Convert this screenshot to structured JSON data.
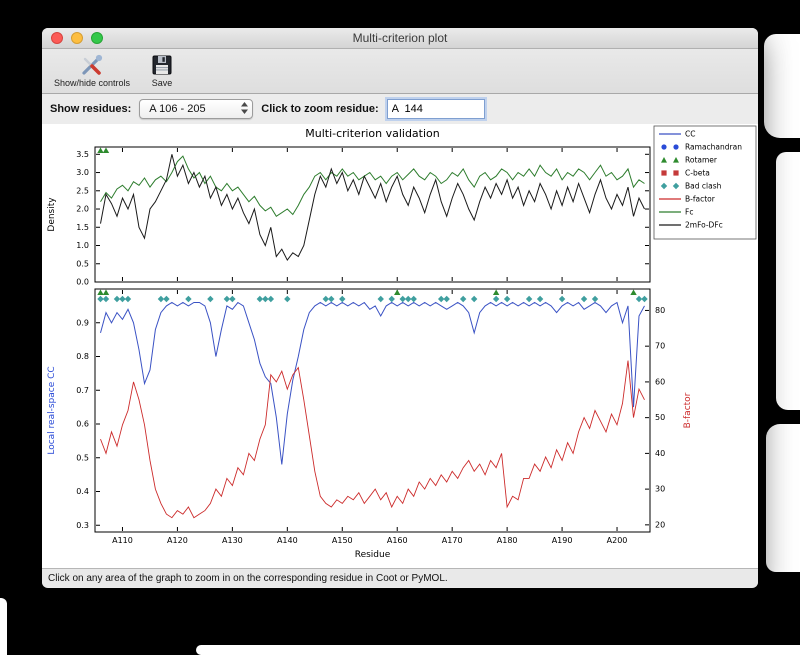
{
  "window": {
    "title": "Multi-criterion plot"
  },
  "toolbar": {
    "show_hide_label": "Show/hide controls",
    "save_label": "Save"
  },
  "controls": {
    "show_residues_label": "Show residues:",
    "residue_range_value": "A 106 - 205",
    "zoom_residue_label": "Click to zoom residue:",
    "zoom_residue_value": "A  144"
  },
  "status": {
    "text": "Click on any area of the graph to zoom in on the corresponding residue in Coot or PyMOL."
  },
  "chart_data": [
    {
      "type": "line",
      "title": "Multi-criterion validation",
      "ylabel": "Density",
      "ylim": [
        0,
        3.7
      ],
      "yticks": [
        0.0,
        0.5,
        1.0,
        1.5,
        2.0,
        2.5,
        3.0,
        3.5
      ],
      "xlim": [
        105,
        206
      ],
      "x_start": 106,
      "series": [
        {
          "name": "Fc",
          "color": "#2e7d2e",
          "width": 1,
          "values": [
            2.2,
            2.45,
            2.3,
            2.55,
            2.65,
            2.5,
            2.75,
            2.65,
            2.85,
            2.6,
            2.8,
            2.9,
            2.75,
            3.0,
            3.3,
            3.45,
            3.1,
            2.85,
            3.0,
            2.7,
            2.9,
            2.6,
            2.5,
            2.7,
            2.5,
            2.6,
            2.4,
            2.2,
            2.35,
            2.1,
            1.95,
            2.05,
            1.8,
            1.9,
            2.0,
            1.85,
            2.1,
            2.4,
            2.6,
            2.9,
            3.0,
            2.8,
            3.0,
            2.9,
            3.1,
            2.9,
            3.0,
            2.8,
            2.9,
            3.0,
            2.8,
            2.9,
            2.7,
            2.9,
            3.0,
            2.8,
            2.95,
            3.1,
            2.9,
            2.8,
            3.0,
            2.9,
            2.7,
            2.8,
            3.0,
            2.9,
            3.1,
            2.8,
            2.6,
            2.9,
            3.0,
            2.8,
            2.9,
            3.1,
            3.0,
            2.8,
            3.0,
            2.9,
            3.1,
            2.9,
            3.2,
            3.0,
            2.9,
            3.1,
            2.8,
            3.0,
            2.9,
            3.1,
            3.0,
            2.8,
            3.0,
            3.2,
            2.9,
            3.0,
            2.8,
            2.9,
            3.1,
            2.6,
            2.8,
            2.7
          ]
        },
        {
          "name": "2mFo-DFc",
          "color": "#1a1a1a",
          "width": 1,
          "values": [
            1.6,
            2.4,
            2.15,
            1.8,
            2.3,
            2.0,
            2.4,
            1.5,
            1.2,
            2.0,
            2.2,
            2.5,
            2.8,
            3.5,
            2.9,
            3.2,
            2.7,
            3.0,
            2.6,
            2.9,
            2.3,
            2.6,
            2.1,
            2.4,
            2.0,
            2.3,
            1.9,
            1.6,
            2.0,
            1.3,
            1.0,
            1.5,
            0.7,
            0.9,
            0.6,
            0.8,
            0.7,
            1.0,
            1.7,
            2.4,
            2.9,
            2.6,
            3.1,
            2.7,
            3.0,
            2.5,
            2.8,
            2.4,
            2.9,
            2.6,
            2.3,
            2.7,
            2.2,
            2.6,
            2.9,
            2.4,
            2.1,
            2.6,
            2.3,
            1.9,
            2.4,
            2.8,
            2.2,
            1.8,
            2.3,
            2.7,
            2.4,
            2.0,
            1.7,
            2.2,
            2.6,
            2.3,
            2.7,
            2.4,
            2.8,
            2.3,
            2.6,
            2.1,
            2.5,
            2.2,
            2.7,
            2.4,
            2.0,
            2.5,
            2.1,
            2.6,
            2.2,
            2.7,
            2.3,
            1.9,
            2.4,
            2.8,
            2.3,
            2.0,
            2.4,
            2.1,
            2.6,
            1.8,
            2.3,
            2.0
          ]
        }
      ],
      "markers": [
        {
          "name": "Rotamer",
          "shape": "triangle",
          "color": "#2e8b2e",
          "residues": [
            106,
            107
          ]
        }
      ],
      "legend": {
        "entries": [
          {
            "label": "CC",
            "type": "line",
            "color": "#3a52c4"
          },
          {
            "label": "Ramachandran",
            "type": "circle",
            "color": "#2a4bd7"
          },
          {
            "label": "Rotamer",
            "type": "triangle",
            "color": "#2e8b2e"
          },
          {
            "label": "C-beta",
            "type": "square",
            "color": "#c43a3a"
          },
          {
            "label": "Bad clash",
            "type": "diamond",
            "color": "#3f9f9f"
          },
          {
            "label": "B-factor",
            "type": "line",
            "color": "#cc2b2b"
          },
          {
            "label": "Fc",
            "type": "line",
            "color": "#2e7d2e"
          },
          {
            "label": "2mFo-DFc",
            "type": "line",
            "color": "#1a1a1a"
          }
        ]
      }
    },
    {
      "type": "line",
      "xlabel": "Residue",
      "ylabel": "Local real-space CC",
      "ylabel_color": "#2a4bd7",
      "ylim": [
        0.28,
        1.0
      ],
      "yticks": [
        0.3,
        0.4,
        0.5,
        0.6,
        0.7,
        0.8,
        0.9
      ],
      "y2label": "B-factor",
      "y2label_color": "#cc2b2b",
      "y2lim": [
        18,
        86
      ],
      "y2ticks": [
        20,
        30,
        40,
        50,
        60,
        70,
        80
      ],
      "xlim": [
        105,
        206
      ],
      "x_start": 106,
      "xticks": [
        110,
        120,
        130,
        140,
        150,
        160,
        170,
        180,
        190,
        200
      ],
      "xtick_prefix": "A",
      "series": [
        {
          "name": "CC",
          "axis": "left",
          "color": "#3a52c4",
          "width": 1,
          "values": [
            0.87,
            0.93,
            0.9,
            0.93,
            0.91,
            0.94,
            0.9,
            0.82,
            0.72,
            0.76,
            0.88,
            0.93,
            0.95,
            0.96,
            0.95,
            0.96,
            0.95,
            0.96,
            0.96,
            0.95,
            0.9,
            0.8,
            0.88,
            0.95,
            0.94,
            0.96,
            0.95,
            0.9,
            0.85,
            0.78,
            0.74,
            0.72,
            0.62,
            0.48,
            0.63,
            0.73,
            0.8,
            0.88,
            0.93,
            0.95,
            0.96,
            0.95,
            0.96,
            0.95,
            0.96,
            0.95,
            0.96,
            0.95,
            0.96,
            0.94,
            0.95,
            0.92,
            0.95,
            0.96,
            0.95,
            0.96,
            0.95,
            0.96,
            0.95,
            0.96,
            0.95,
            0.96,
            0.95,
            0.94,
            0.95,
            0.96,
            0.95,
            0.93,
            0.87,
            0.93,
            0.95,
            0.96,
            0.95,
            0.96,
            0.95,
            0.96,
            0.95,
            0.96,
            0.95,
            0.96,
            0.95,
            0.96,
            0.95,
            0.93,
            0.95,
            0.96,
            0.95,
            0.96,
            0.94,
            0.95,
            0.96,
            0.95,
            0.93,
            0.95,
            0.96,
            0.9,
            0.95,
            0.65,
            0.92,
            0.95
          ]
        },
        {
          "name": "B-factor",
          "axis": "right",
          "color": "#cc2b2b",
          "width": 0.9,
          "values": [
            44,
            40,
            46,
            42,
            48,
            52,
            60,
            55,
            48,
            38,
            30,
            26,
            23,
            22,
            24,
            23,
            25,
            22,
            23,
            24,
            26,
            30,
            28,
            33,
            31,
            36,
            34,
            40,
            38,
            44,
            48,
            62,
            60,
            63,
            58,
            62,
            64,
            55,
            45,
            35,
            28,
            26,
            25,
            27,
            26,
            28,
            27,
            29,
            26,
            28,
            30,
            27,
            29,
            25,
            28,
            26,
            30,
            28,
            32,
            30,
            33,
            31,
            34,
            32,
            35,
            33,
            36,
            38,
            35,
            37,
            34,
            38,
            36,
            40,
            25,
            28,
            27,
            33,
            33,
            37,
            35,
            39,
            36,
            41,
            38,
            43,
            40,
            46,
            50,
            47,
            52,
            49,
            46,
            51,
            48,
            54,
            66,
            50,
            58,
            55
          ]
        }
      ],
      "markers": [
        {
          "name": "Rotamer",
          "shape": "triangle",
          "color": "#2e8b2e",
          "residues": [
            106,
            107,
            160,
            178,
            203
          ]
        },
        {
          "name": "Bad clash",
          "shape": "diamond",
          "color": "#3f9f9f",
          "residues": [
            106,
            107,
            109,
            110,
            111,
            117,
            118,
            122,
            126,
            129,
            130,
            135,
            136,
            137,
            140,
            147,
            148,
            150,
            157,
            159,
            161,
            162,
            163,
            168,
            169,
            172,
            174,
            178,
            180,
            184,
            186,
            190,
            194,
            196,
            204,
            205
          ]
        }
      ]
    }
  ]
}
